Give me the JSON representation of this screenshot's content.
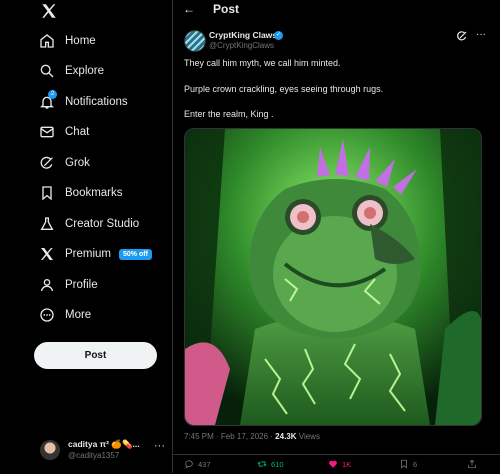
{
  "nav": {
    "items": [
      {
        "label": "Home",
        "icon": "home-icon"
      },
      {
        "label": "Explore",
        "icon": "search-icon"
      },
      {
        "label": "Notifications",
        "icon": "bell-icon",
        "badge": "2"
      },
      {
        "label": "Chat",
        "icon": "mail-icon"
      },
      {
        "label": "Grok",
        "icon": "grok-icon"
      },
      {
        "label": "Bookmarks",
        "icon": "bookmark-icon"
      },
      {
        "label": "Creator Studio",
        "icon": "flask-icon"
      },
      {
        "label": "Premium",
        "icon": "x-logo-icon",
        "tag": "50% off"
      },
      {
        "label": "Profile",
        "icon": "person-icon"
      },
      {
        "label": "More",
        "icon": "more-circle-icon"
      }
    ],
    "post_button": "Post"
  },
  "account": {
    "name": "caditya π² 🍊💊...",
    "handle": "@caditya1357",
    "more": "···"
  },
  "header": {
    "back": "←",
    "title": "Post"
  },
  "tweet": {
    "author_name": "CryptKing Claws",
    "author_handle": "@CryptKingClaws",
    "lines": [
      "They call him myth, we call him minted.",
      "Purple crown crackling, eyes seeing through rugs.",
      "Enter the realm, King ."
    ],
    "time": "7:45 PM · Feb 17, 2026 · ",
    "views_count": "24.3K",
    "views_label": " Views",
    "replies": "437",
    "reposts": "610",
    "likes": "1K",
    "bookmarks": "6"
  },
  "colors": {
    "accent": "#1d9bf0",
    "repost": "#00ba7c",
    "like": "#f91880",
    "background": "#000000"
  }
}
